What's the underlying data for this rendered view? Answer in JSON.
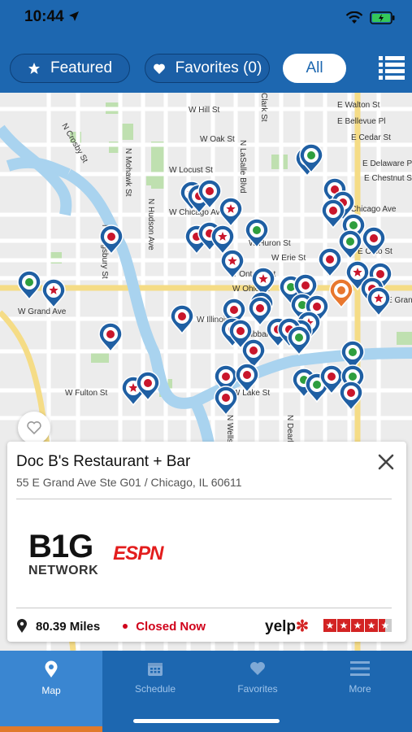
{
  "status_bar": {
    "time": "10:44"
  },
  "filters": {
    "featured_label": "Featured",
    "favorites_label": "Favorites (0)",
    "all_label": "All"
  },
  "map": {
    "street_labels": [
      "W Hill St",
      "N Crosby St",
      "W Oak St",
      "Clark St",
      "N Mohawk St",
      "N Hudson Ave",
      "W Locust St",
      "W Chicago Ave",
      "N LaSalle Blvd",
      "N Kingsbury St",
      "W Huron St",
      "W Erie St",
      "W Ontario St",
      "W Ohio St",
      "W Grand Ave",
      "W Illinois St",
      "W Hubbard St",
      "W Fulton St",
      "W Lake St",
      "N Wells St",
      "N Dearborn St",
      "E Walton St",
      "E Bellevue Pl",
      "E Cedar St",
      "E Delaware Pl",
      "E Chestnut St",
      "E Chicago Ave",
      "E Grand Ave",
      "E Ohio St"
    ],
    "pin_colors": {
      "pin": "#1f5fa3",
      "red": "#c9162b",
      "green": "#2e9e3e",
      "selected": "#e8772e"
    }
  },
  "venue": {
    "name": "Doc B's Restaurant + Bar",
    "address": "55 E Grand Ave Ste G01 / Chicago, IL 60611",
    "network_logo_top": "B1G",
    "network_logo_bottom": "NETWORK",
    "espn_logo": "ESPN",
    "distance": "80.39 Miles",
    "status": "Closed Now",
    "review_source": "yelp",
    "rating_stars": 4.5
  },
  "tabs": [
    {
      "label": "Map",
      "icon": "map-pin-icon"
    },
    {
      "label": "Schedule",
      "icon": "calendar-icon"
    },
    {
      "label": "Favorites",
      "icon": "heart-icon"
    },
    {
      "label": "More",
      "icon": "menu-icon"
    }
  ]
}
